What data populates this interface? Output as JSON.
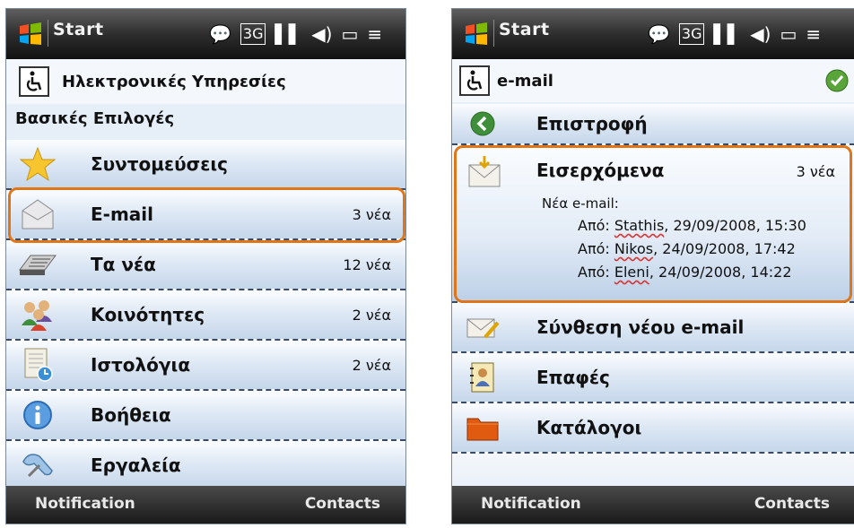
{
  "statusbar": {
    "start": "Start"
  },
  "left": {
    "header_title": "Ηλεκτρονικές Υπηρεσίες",
    "section_title": "Βασικές Επιλογές",
    "items": [
      {
        "label": "Συντομεύσεις",
        "count": "",
        "icon": "star-icon"
      },
      {
        "label": "E-mail",
        "count": "3 νέα",
        "icon": "envelope-icon"
      },
      {
        "label": "Τα νέα",
        "count": "12 νέα",
        "icon": "newspaper-icon"
      },
      {
        "label": "Κοινότητες",
        "count": "2 νέα",
        "icon": "people-icon"
      },
      {
        "label": "Ιστολόγια",
        "count": "2 νέα",
        "icon": "blog-icon"
      },
      {
        "label": "Βοήθεια",
        "count": "",
        "icon": "info-icon"
      },
      {
        "label": "Εργαλεία",
        "count": "",
        "icon": "tools-icon"
      }
    ],
    "softkeys": {
      "left": "Notification",
      "right": "Contacts"
    }
  },
  "right": {
    "header_title": "e-mail",
    "back": "Επιστροφή",
    "inbox": {
      "label": "Εισερχόμενα",
      "count": "3 νέα",
      "subtitle": "Νέα e-mail:",
      "messages": [
        {
          "prefix": "Από:",
          "sender": "Stathis",
          "rest": ", 29/09/2008, 15:30"
        },
        {
          "prefix": "Από:",
          "sender": "Nikos",
          "rest": ", 24/09/2008, 17:42"
        },
        {
          "prefix": "Από:",
          "sender": "Eleni",
          "rest": ", 24/09/2008, 14:22"
        }
      ]
    },
    "compose": "Σύνθεση νέου e-mail",
    "contacts": "Επαφές",
    "folders": "Κατάλογοι",
    "softkeys": {
      "left": "Notification",
      "right": "Contacts"
    }
  },
  "colors": {
    "highlight": "#e0761a",
    "divider": "#3a4a66"
  }
}
